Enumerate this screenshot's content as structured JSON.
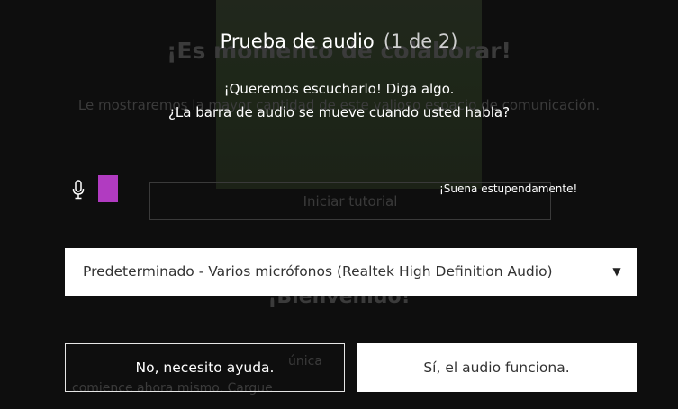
{
  "background": {
    "headline": "¡Es momento de colaborar!",
    "subtext": "Le mostraremos la mayor cantidad de este valioso espacio de comunicación.",
    "input_label": "Iniciar tutorial",
    "welcome": "¡Bienvenido!",
    "unique_fragment": "única",
    "start_fragment": "comience ahora mismo. Cargue"
  },
  "dialog": {
    "title": "Prueba de audio",
    "step": "(1 de 2)",
    "line1": "¡Queremos escucharlo! Diga algo.",
    "line2": "¿La barra de audio se mueve cuando usted habla?",
    "mic_icon": "microphone-icon",
    "level_color": "#b13bc1",
    "status_text": "¡Suena estupendamente!",
    "microphone_select": {
      "selected": "Predeterminado - Varios micrófonos (Realtek High Definition Audio)",
      "arrow_icon": "dropdown-arrow-icon"
    },
    "buttons": {
      "no_label": "No, necesito ayuda.",
      "yes_label": "Sí, el audio funciona."
    }
  }
}
